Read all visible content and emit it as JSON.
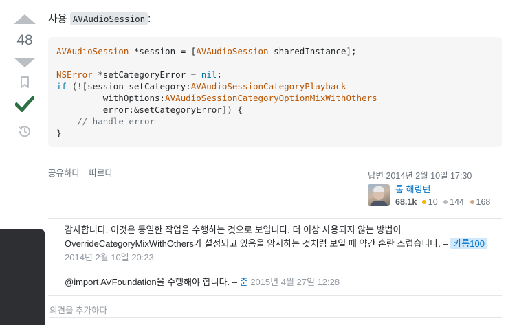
{
  "vote": {
    "count": "48"
  },
  "post": {
    "intro_prefix": "사용",
    "intro_code": "AVAudioSession",
    "intro_suffix": ":",
    "code_lines": [
      [
        {
          "t": "ty",
          "v": "AVAudioSession"
        },
        {
          "t": "pl",
          "v": " *session = ["
        },
        {
          "t": "ty",
          "v": "AVAudioSession"
        },
        {
          "t": "pl",
          "v": " sharedInstance];"
        }
      ],
      [],
      [
        {
          "t": "ty",
          "v": "NSError"
        },
        {
          "t": "pl",
          "v": " *setCategoryError = "
        },
        {
          "t": "kw",
          "v": "nil"
        },
        {
          "t": "pl",
          "v": ";"
        }
      ],
      [
        {
          "t": "kw",
          "v": "if"
        },
        {
          "t": "pl",
          "v": " (![session setCategory:"
        },
        {
          "t": "ty",
          "v": "AVAudioSessionCategoryPlayback"
        }
      ],
      [
        {
          "t": "pl",
          "v": "         withOptions:"
        },
        {
          "t": "ty",
          "v": "AVAudioSessionCategoryOptionMixWithOthers"
        }
      ],
      [
        {
          "t": "pl",
          "v": "         error:&setCategoryError]) {"
        }
      ],
      [
        {
          "t": "pl",
          "v": "    "
        },
        {
          "t": "cm",
          "v": "// handle error"
        }
      ],
      [
        {
          "t": "pl",
          "v": "}"
        }
      ]
    ]
  },
  "menu": {
    "share": "공유하다",
    "follow": "따르다"
  },
  "user": {
    "answered": "답변 2014년 2월 10일 17:30",
    "name": "톰 해링턴",
    "reputation": "68.1k",
    "gold": "10",
    "silver": "144",
    "bronze": "168",
    "colors": {
      "gold": "#f1b600",
      "silver": "#b4b8bc",
      "bronze": "#d1a684"
    }
  },
  "comments": [
    {
      "text": "감사합니다. 이것은 동일한 작업을 수행하는 것으로 보입니다. 더 이상 사용되지 않는 방법이 OverrideCategoryMixWithOthers가 설정되고 있음을 암시하는 것처럼 보일 때 약간 혼란 스럽습니다. –",
      "user": "카름100",
      "date": "2014년 2월 10일 20:23"
    },
    {
      "text": "@import AVFoundation을 수행해야 합니다. –",
      "user": "준",
      "date": "2015년 4월 27일 12:28"
    }
  ],
  "add_comment": "의견을 추가하다",
  "icons": {
    "upvote": "triangle-up-icon",
    "downvote": "triangle-down-icon",
    "bookmark": "bookmark-icon",
    "accepted": "checkmark-icon",
    "history": "history-icon"
  },
  "colors": {
    "accepted": "#2f6f44",
    "vote_arrow": "#babfc4",
    "link": "#0074cc"
  }
}
